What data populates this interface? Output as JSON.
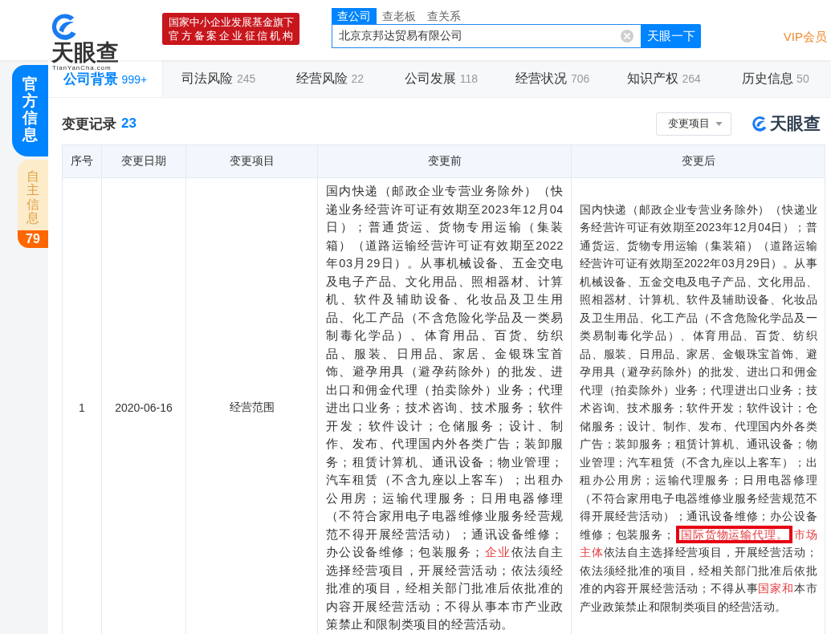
{
  "header": {
    "logo": {
      "wordmark": "天眼查",
      "domain": "TianYanCha.com"
    },
    "banner_lines": [
      "国家中小企业发展基金旗下",
      "官方备案企业征信机构"
    ],
    "search": {
      "tabs": [
        {
          "label": "查公司",
          "selected": true
        },
        {
          "label": "查老板",
          "selected": false
        },
        {
          "label": "查关系",
          "selected": false
        }
      ],
      "value": "北京京邦达贸易有限公司",
      "button": "天眼一下"
    },
    "vip_link": "VIP会员"
  },
  "sidebar": {
    "items": [
      {
        "label": "官方信息",
        "selected": true
      },
      {
        "label": "自主信息",
        "selected": false,
        "badge": "79"
      }
    ]
  },
  "nav": {
    "tabs": [
      {
        "label": "公司背景",
        "count": "999+",
        "selected": true
      },
      {
        "label": "司法风险",
        "count": "245",
        "selected": false
      },
      {
        "label": "经营风险",
        "count": "22",
        "selected": false
      },
      {
        "label": "公司发展",
        "count": "118",
        "selected": false
      },
      {
        "label": "经营状况",
        "count": "706",
        "selected": false
      },
      {
        "label": "知识产权",
        "count": "264",
        "selected": false
      },
      {
        "label": "历史信息",
        "count": "50",
        "selected": false
      }
    ]
  },
  "section": {
    "title": "变更记录",
    "count": "23",
    "filter": "变更项目",
    "brand_mark": "天眼查"
  },
  "table": {
    "columns": [
      "序号",
      "变更日期",
      "变更项目",
      "变更前",
      "变更后"
    ],
    "rows": [
      {
        "index": "1",
        "date": "2020-06-16",
        "item": "经营范围",
        "before": [
          {
            "text": "国内快递（邮政企业专营业务除外）（快递业务经营许可证有效期至2023年12月04日）；普通货运、货物专用运输（集装箱）（道路运输经营许可证有效期至2022年03月29日）。从事机械设备、五金交电及电子产品、文化用品、照相器材、计算机、软件及辅助设备、化妆品及卫生用品、化工产品（不含危险化学品及一类易制毒化学品）、体育用品、百货、纺织品、服装、日用品、家居、金银珠宝首饰、避孕用具（避孕药除外）的批发、进出口和佣金代理（拍卖除外）业务；代理进出口业务；技术咨询、技术服务；软件开发；软件设计；仓储服务；设计、制作、发布、代理国内外各类广告；装卸服务；租赁计算机、通讯设备；物业管理；汽车租赁（不含九座以上客车）；出租办公用房；运输代理服务；日用电器修理（不符合家用电子电器维修业服务经营规范不得开展经营活动）；通讯设备维修；办公设备维修；包装服务；",
            "changed": false,
            "boxed": false
          },
          {
            "text": "企业",
            "changed": true,
            "boxed": false
          },
          {
            "text": "依法自主选择经营项目，开展经营活动；依法须经批准的项目，经相关部门批准后依批准的内容开展经营活动；不得从事本市产业政策禁止和限制类项目的经营活动。",
            "changed": false,
            "boxed": false
          }
        ],
        "after": [
          {
            "text": "国内快递（邮政企业专营业务除外）（快递业务经营许可证有效期至2023年12月04日）；普通货运、货物专用运输（集装箱）（道路运输经营许可证有效期至2022年03月29日）。从事机械设备、五金交电及电子产品、文化用品、照相器材、计算机、软件及辅助设备、化妆品及卫生用品、化工产品（不含危险化学品及一类易制毒化学品）、体育用品、百货、纺织品、服装、日用品、家居、金银珠宝首饰、避孕用具（避孕药除外）的批发、进出口和佣金代理（拍卖除外）业务；代理进出口业务；技术咨询、技术服务；软件开发；软件设计；仓储服务；设计、制作、发布、代理国内外各类广告；装卸服务；租赁计算机、通讯设备；物业管理；汽车租赁（不含九座以上客车）；出租办公用房；运输代理服务；日用电器修理（不符合家用电子电器维修业服务经营规范不得开展经营活动）；通讯设备维修；办公设备维修；包装服务；",
            "changed": false,
            "boxed": false
          },
          {
            "text": "国际货物运输代理。",
            "changed": true,
            "boxed": true
          },
          {
            "text": "市场主体",
            "changed": true,
            "boxed": false
          },
          {
            "text": "依法自主选择经营项目，开展经营活动；依法须经批准的项目，经相关部门批准后依批准的内容开展经营活动；不得从事",
            "changed": false,
            "boxed": false
          },
          {
            "text": "国家和",
            "changed": true,
            "boxed": false
          },
          {
            "text": "本市产业政策禁止和限制类项目的经营活动。",
            "changed": false,
            "boxed": false
          }
        ]
      }
    ]
  }
}
